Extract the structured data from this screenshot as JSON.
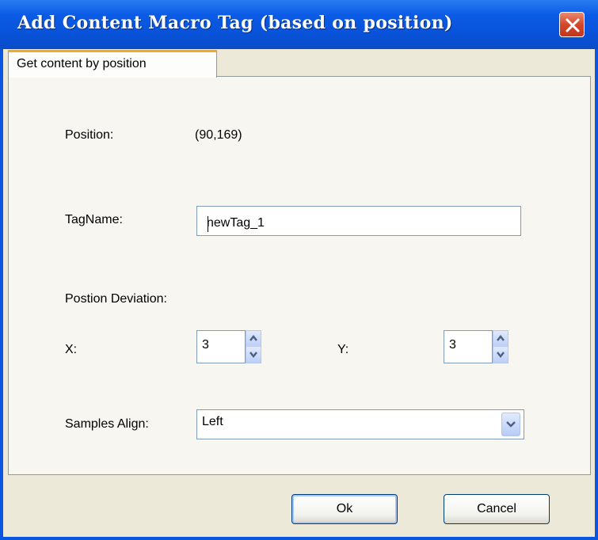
{
  "window": {
    "title": "Add Content Macro Tag (based on position)"
  },
  "tabs": [
    {
      "label": "Get content by position"
    }
  ],
  "form": {
    "position_label": "Position:",
    "position_value": "(90,169)",
    "tagname_label": "TagName:",
    "tagname_value": "newTag_1",
    "deviation_label": "Postion Deviation:",
    "x_label": "X:",
    "x_value": "3",
    "y_label": "Y:",
    "y_value": "3",
    "align_label": "Samples Align:",
    "align_value": "Left"
  },
  "buttons": {
    "ok": "Ok",
    "cancel": "Cancel"
  },
  "colors": {
    "title_bar": "#0852d8",
    "tab_accent": "#f5a623",
    "dialog_bg": "#ece9d8"
  }
}
